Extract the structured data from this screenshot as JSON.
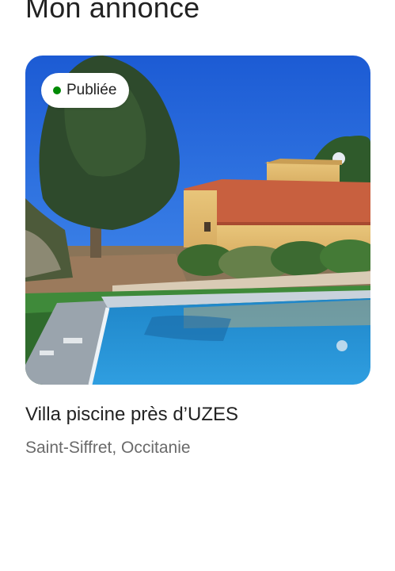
{
  "header": {
    "title": "Mon annonce"
  },
  "listing": {
    "status": {
      "label": "Publiée",
      "dot_color": "#008a05"
    },
    "photo_description_icon": "villa-pool-photo",
    "title": "Villa piscine près d’UZES",
    "location": "Saint-Siffret, Occitanie"
  }
}
